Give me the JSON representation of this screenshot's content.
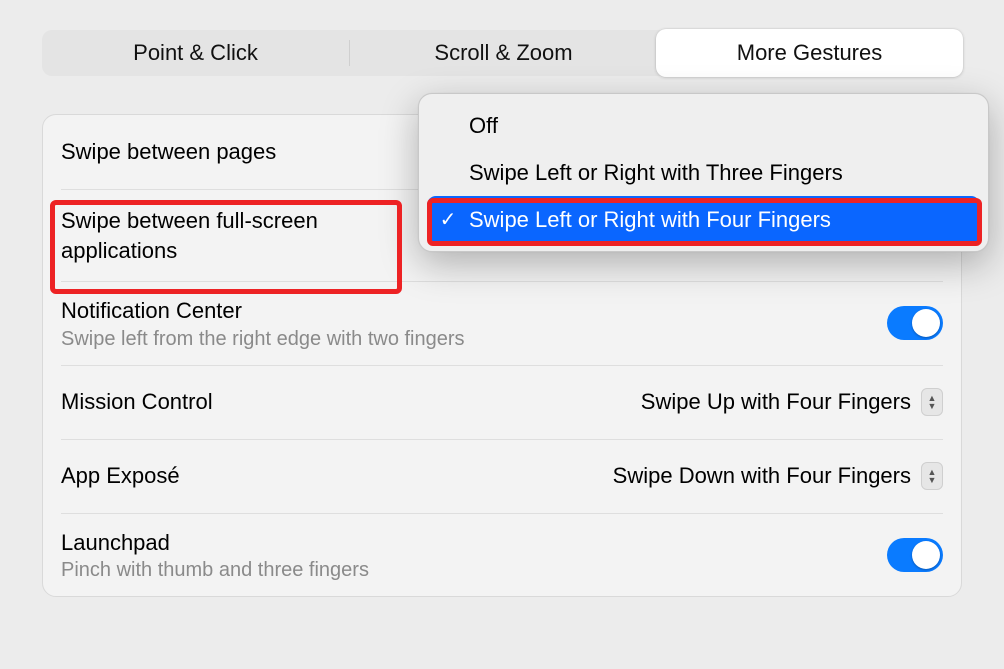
{
  "tabs": {
    "point_click": "Point & Click",
    "scroll_zoom": "Scroll & Zoom",
    "more_gestures": "More Gestures"
  },
  "rows": {
    "swipe_pages": {
      "title": "Swipe between pages"
    },
    "swipe_fullscreen": {
      "title": "Swipe between full-screen applications"
    },
    "notification_center": {
      "title": "Notification Center",
      "sub": "Swipe left from the right edge with two fingers"
    },
    "mission_control": {
      "title": "Mission Control",
      "value": "Swipe Up with Four Fingers"
    },
    "app_expose": {
      "title": "App Exposé",
      "value": "Swipe Down with Four Fingers"
    },
    "launchpad": {
      "title": "Launchpad",
      "sub": "Pinch with thumb and three fingers"
    }
  },
  "dropdown": {
    "off": "Off",
    "three": "Swipe Left or Right with Three Fingers",
    "four": "Swipe Left or Right with Four Fingers",
    "checkmark": "✓"
  }
}
